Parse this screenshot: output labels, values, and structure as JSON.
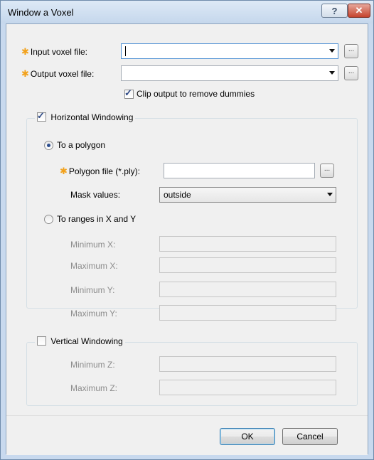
{
  "window": {
    "title": "Window a Voxel",
    "help_label": "?",
    "close_label": "✕"
  },
  "input_voxel": {
    "label": "Input voxel file:",
    "value": "",
    "browse_label": "..."
  },
  "output_voxel": {
    "label": "Output voxel file:",
    "value": "",
    "browse_label": "..."
  },
  "clip_output": {
    "label": "Clip output to remove dummies",
    "checked": true
  },
  "horizontal": {
    "title": "Horizontal Windowing",
    "checked": true,
    "polygon_option": "To a polygon",
    "polygon_file_label": "Polygon file (*.ply):",
    "polygon_file_value": "",
    "browse_label": "...",
    "mask_label": "Mask values:",
    "mask_value": "outside",
    "ranges_option": "To ranges in X and Y",
    "min_x_label": "Minimum X:",
    "max_x_label": "Maximum X:",
    "min_y_label": "Minimum Y:",
    "max_y_label": "Maximum Y:",
    "selected": "polygon"
  },
  "vertical": {
    "title": "Vertical Windowing",
    "checked": false,
    "min_z_label": "Minimum Z:",
    "max_z_label": "Maximum Z:"
  },
  "buttons": {
    "ok": "OK",
    "cancel": "Cancel"
  },
  "icons": {
    "required_marker": "required-star-icon",
    "dropdown": "chevron-down-icon"
  },
  "colors": {
    "required": "#f2a11a",
    "title_bar": "#c5d7ec",
    "close_button": "#c6432d",
    "focus_border": "#4d90d4"
  }
}
